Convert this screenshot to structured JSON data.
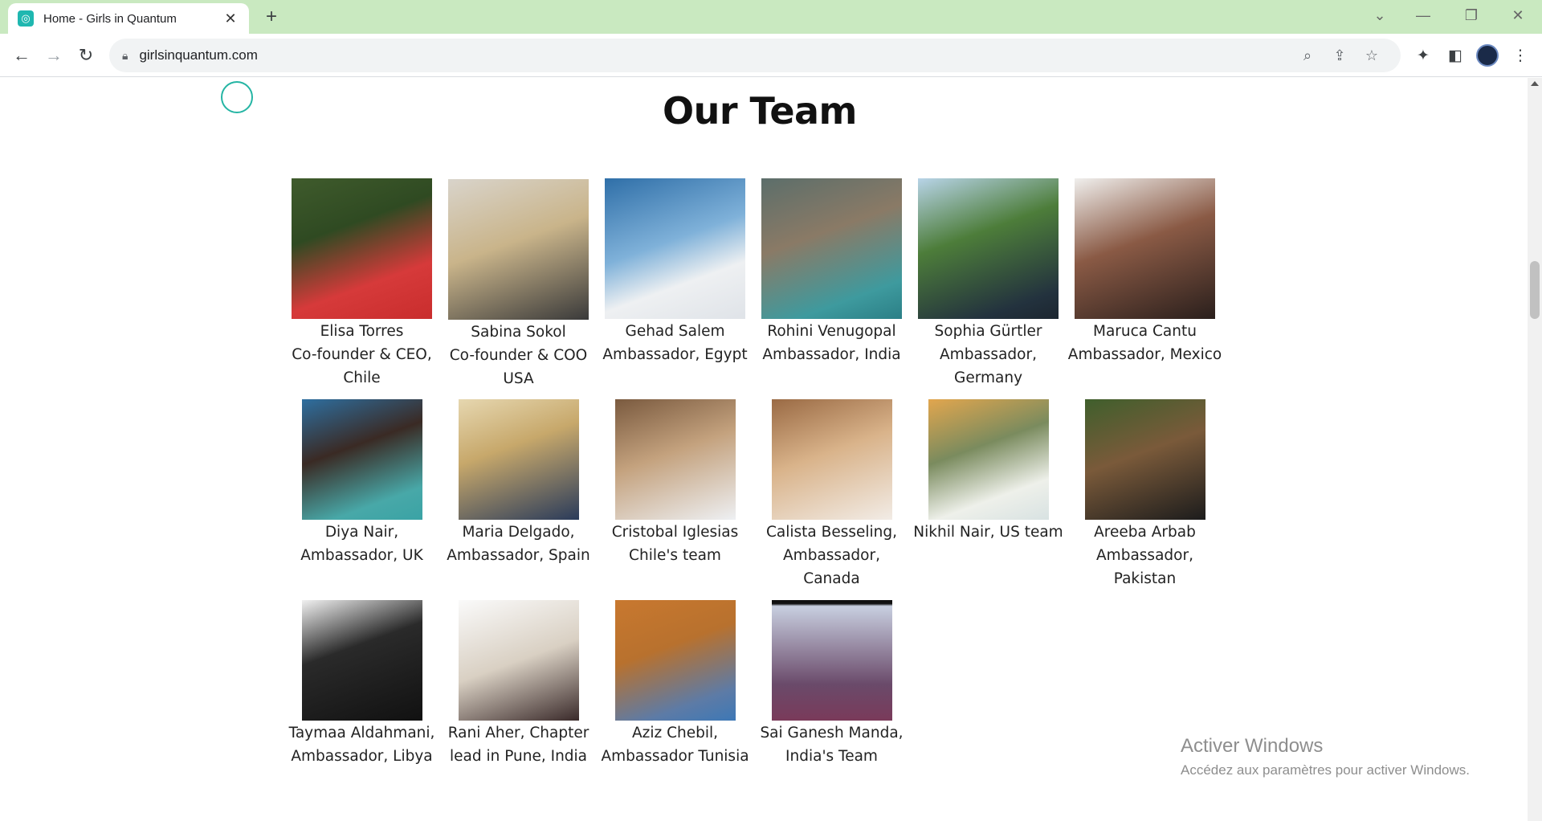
{
  "browser": {
    "tab_title": "Home - Girls in Quantum",
    "url": "girlsinquantum.com",
    "new_tab": "+",
    "close_tab": "✕"
  },
  "page": {
    "heading": "Our Team",
    "members": [
      {
        "line1": "Elisa Torres",
        "line2": "Co-founder & CEO,",
        "line3": "Chile"
      },
      {
        "line1": "Sabina Sokol",
        "line2": "Co-founder & COO",
        "line3": "USA"
      },
      {
        "line1": "Gehad Salem",
        "line2": "Ambassador, Egypt",
        "line3": ""
      },
      {
        "line1": "Rohini Venugopal",
        "line2": "Ambassador, India",
        "line3": ""
      },
      {
        "line1": "Sophia Gürtler",
        "line2": "Ambassador,",
        "line3": "Germany"
      },
      {
        "line1": "Maruca Cantu",
        "line2": "Ambassador, Mexico",
        "line3": ""
      },
      {
        "line1": "Diya Nair,",
        "line2": "Ambassador, UK",
        "line3": ""
      },
      {
        "line1": "Maria Delgado,",
        "line2": "Ambassador, Spain",
        "line3": ""
      },
      {
        "line1": "Cristobal Iglesias",
        "line2": "Chile's team",
        "line3": ""
      },
      {
        "line1": "Calista Besseling,",
        "line2": "Ambassador,",
        "line3": "Canada"
      },
      {
        "line1": "Nikhil Nair, US team",
        "line2": "",
        "line3": ""
      },
      {
        "line1": "Areeba Arbab",
        "line2": "Ambassador,",
        "line3": "Pakistan"
      },
      {
        "line1": "Taymaa Aldahmani,",
        "line2": "Ambassador, Libya",
        "line3": ""
      },
      {
        "line1": "Rani Aher, Chapter",
        "line2": "lead in Pune, India",
        "line3": ""
      },
      {
        "line1": "Aziz Chebil,",
        "line2": "Ambassador Tunisia",
        "line3": ""
      },
      {
        "line1": "Sai Ganesh Manda,",
        "line2": "India's Team",
        "line3": ""
      }
    ]
  },
  "os_watermark": {
    "title": "Activer Windows",
    "subtitle": "Accédez aux paramètres pour activer Windows."
  },
  "colors": {
    "tabbar": "#c9e9c0",
    "accent": "#1fb7b0"
  }
}
